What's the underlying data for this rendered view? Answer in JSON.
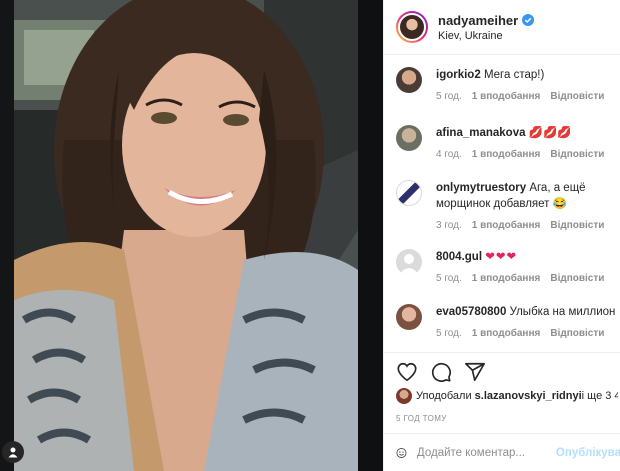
{
  "post": {
    "username": "nadyameiher",
    "location": "Kiev, Ukraine",
    "verified_icon": "verified-badge-icon"
  },
  "comments": [
    {
      "user": "igorkio2",
      "text": "Мега стар!)",
      "time": "5 год.",
      "likes": "1 вподобання",
      "reply": "Відповісти"
    },
    {
      "user": "afina_manakova",
      "text": "💋💋💋",
      "time": "4 год.",
      "likes": "1 вподобання",
      "reply": "Відповісти"
    },
    {
      "user": "onlymytruestory",
      "text": "Ага, а ещё морщинок добавляет 😂",
      "time": "3 год.",
      "likes": "1 вподобання",
      "reply": "Відповісти"
    },
    {
      "user": "8004.gul",
      "text": "❤❤❤",
      "time": "5 год.",
      "likes": "1 вподобання",
      "reply": "Відповісти"
    },
    {
      "user": "eva05780800",
      "text": "Улыбка на миллион",
      "time": "5 год.",
      "likes": "1 вподобання",
      "reply": "Відповісти"
    }
  ],
  "likes": {
    "prefix": "Уподобали",
    "user": "s.lazanovskyi_ridnyi",
    "suffix": " і ще 3 4"
  },
  "time_ago": "5 ГОД ТОМУ",
  "add_comment": {
    "placeholder": "Додайте коментар...",
    "post_label": "Опублікува"
  },
  "colors": {
    "accent": "#0095f6",
    "post_button_disabled": "#b2dffc",
    "heart": "#e0245e",
    "meta_gray": "#8e8e8e"
  }
}
